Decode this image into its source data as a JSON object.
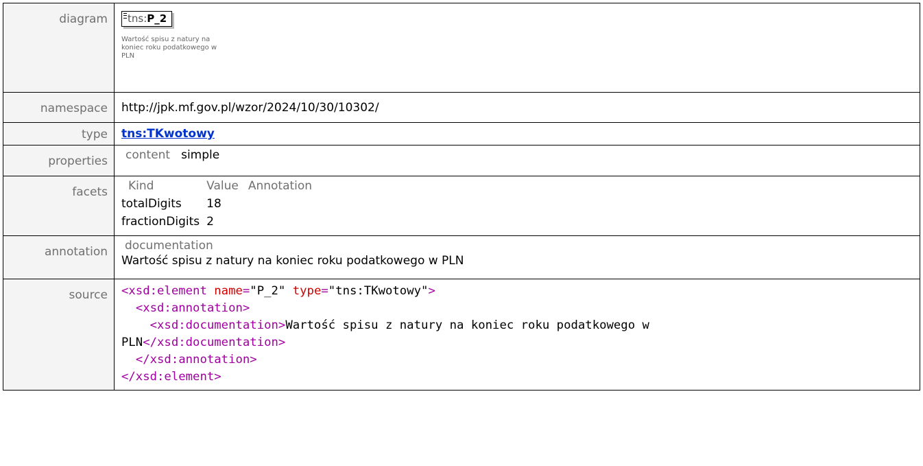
{
  "labels": {
    "diagram": "diagram",
    "namespace": "namespace",
    "type": "type",
    "properties": "properties",
    "facets": "facets",
    "annotation": "annotation",
    "source": "source"
  },
  "diagram": {
    "prefix": "tns:",
    "name": "P_2",
    "documentation": "Wartość spisu z natury na koniec roku podatkowego w PLN"
  },
  "namespace": "http://jpk.mf.gov.pl/wzor/2024/10/30/10302/",
  "type_link": "tns:TKwotowy",
  "properties": {
    "key": "content",
    "value": "simple"
  },
  "facets": {
    "headers": [
      "Kind",
      "Value",
      "Annotation"
    ],
    "rows": [
      {
        "kind": "totalDigits",
        "value": "18"
      },
      {
        "kind": "fractionDigits",
        "value": "2"
      }
    ]
  },
  "annotation": {
    "header": "documentation",
    "text": "Wartość spisu z natury na koniec roku podatkowego w PLN"
  },
  "source": {
    "open_element": "<xsd:element",
    "attr1_name": "name",
    "attr1_value": "\"P_2\"",
    "attr2_name": "type",
    "attr2_value": "\"tns:TKwotowy\"",
    "close_bracket": ">",
    "open_annotation": "<xsd:annotation>",
    "open_documentation": "<xsd:documentation>",
    "doc_text_line1": "Wartość spisu z natury na koniec roku podatkowego w",
    "doc_text_line2": "PLN",
    "close_documentation": "</xsd:documentation>",
    "close_annotation": "</xsd:annotation>",
    "close_element": "</xsd:element>"
  },
  "colors": {
    "tag": "#a000a0",
    "attribute": "#d00000",
    "link": "#0033cc"
  }
}
